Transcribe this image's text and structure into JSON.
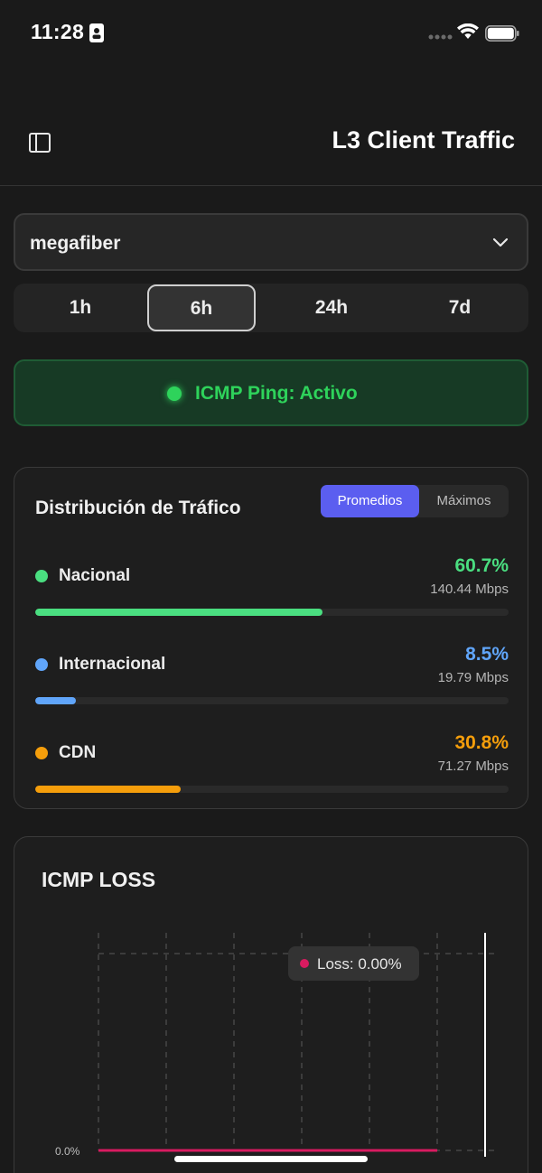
{
  "status_bar": {
    "time": "11:28"
  },
  "header": {
    "title": "L3 Client Traffic"
  },
  "site_select": {
    "value": "megafiber"
  },
  "range_tabs": [
    {
      "label": "1h",
      "active": false
    },
    {
      "label": "6h",
      "active": true
    },
    {
      "label": "24h",
      "active": false
    },
    {
      "label": "7d",
      "active": false
    }
  ],
  "ping": {
    "label": "ICMP Ping: Activo",
    "color": "#2ed35b"
  },
  "distribution": {
    "title": "Distribución de Tráfico",
    "toggle": [
      {
        "label": "Promedios",
        "active": true
      },
      {
        "label": "Máximos",
        "active": false
      }
    ],
    "rows": [
      {
        "name": "Nacional",
        "percent": "60.7%",
        "mbps": "140.44 Mbps",
        "fraction": 0.607,
        "color": "#4ade80"
      },
      {
        "name": "Internacional",
        "percent": "8.5%",
        "mbps": "19.79 Mbps",
        "fraction": 0.085,
        "color": "#60a5fa"
      },
      {
        "name": "CDN",
        "percent": "30.8%",
        "mbps": "71.27 Mbps",
        "fraction": 0.308,
        "color": "#f59e0b"
      }
    ]
  },
  "loss_chart": {
    "title": "ICMP LOSS",
    "tooltip": "Loss: 0.00%",
    "series_color": "#d81b60",
    "chart_data": {
      "type": "line",
      "title": "ICMP LOSS",
      "series": [
        {
          "name": "Loss",
          "values": [
            0,
            0,
            0,
            0,
            0,
            0,
            0
          ]
        }
      ],
      "ytick_labels": [
        "0.0%"
      ],
      "grid": true
    }
  }
}
